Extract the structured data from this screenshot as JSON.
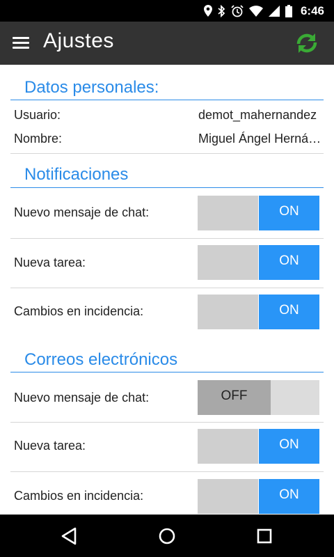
{
  "status_bar": {
    "time": "6:46",
    "icons": [
      "location-icon",
      "bluetooth-icon",
      "alarm-icon",
      "wifi-icon",
      "signal-icon",
      "battery-icon"
    ]
  },
  "app_bar": {
    "title": "Ajustes",
    "menu_icon": "hamburger-menu-icon",
    "refresh_icon": "refresh-sync-icon",
    "refresh_color": "#3aaa35"
  },
  "datos": {
    "title": "Datos personales:",
    "usuario_label": "Usuario:",
    "usuario_value": "demot_mahernandez",
    "nombre_label": "Nombre:",
    "nombre_value": "Miguel Ángel Hernández"
  },
  "notificaciones": {
    "title": "Notificaciones",
    "items": [
      {
        "label": "Nuevo mensaje de chat:",
        "state": "ON"
      },
      {
        "label": "Nueva tarea:",
        "state": "ON"
      },
      {
        "label": "Cambios en incidencia:",
        "state": "ON"
      }
    ]
  },
  "correos": {
    "title": "Correos electrónicos",
    "items": [
      {
        "label": "Nuevo mensaje de chat:",
        "state": "OFF"
      },
      {
        "label": "Nueva tarea:",
        "state": "ON"
      },
      {
        "label": "Cambios en incidencia:",
        "state": "ON"
      }
    ]
  },
  "colors": {
    "accent": "#2a8be8",
    "toggle_on": "#2995f7",
    "app_bar": "#333333"
  },
  "nav_bar": {
    "icons": [
      "back-icon",
      "home-icon",
      "recents-icon"
    ]
  }
}
